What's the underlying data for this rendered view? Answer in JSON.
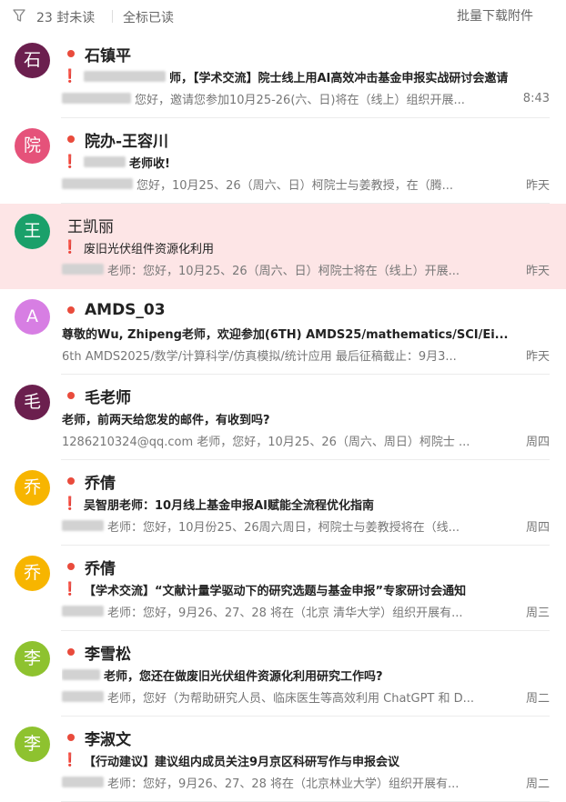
{
  "toolbar": {
    "filter_icon": "filter-icon",
    "unread_count_text": "23 封未读",
    "mark_all_read": "全标已读",
    "batch_download": "批量下载附件"
  },
  "colors": {
    "unread_dot": "#e94b3c",
    "flag": "#e02020",
    "selected_row": "#fde5e6"
  },
  "emails": [
    {
      "avatar": "石",
      "avatar_color": "#6b1f4e",
      "sender": "石镇平",
      "unread": true,
      "flag": true,
      "flag_symbol": "❗",
      "subject_prefix_blur": 90,
      "subject": "师，【学术交流】院士线上用AI高效冲击基金申报实战研讨会邀请",
      "preview_prefix_blur": 76,
      "preview": "您好，邀请您参加10月25-26(六、日)将在（线上）组织开展...",
      "time": "8:43",
      "selected": false
    },
    {
      "avatar": "院",
      "avatar_color": "#e5527a",
      "sender": "院办-王容川",
      "unread": true,
      "flag": true,
      "flag_symbol": "❗",
      "subject_prefix_blur": 46,
      "subject": "老师收!",
      "preview_prefix_blur": 78,
      "preview": "您好，10月25、26（周六、日）柯院士与姜教授，在（腾...",
      "time": "昨天",
      "selected": false
    },
    {
      "avatar": "王",
      "avatar_color": "#1aa06a",
      "sender": "王凯丽",
      "unread": false,
      "flag": true,
      "flag_symbol": "❗",
      "subject_prefix_blur": 0,
      "subject": "废旧光伏组件资源化利用",
      "preview_prefix_blur": 46,
      "preview": "老师：您好，10月25、26（周六、日）柯院士将在（线上）开展...",
      "time": "昨天",
      "selected": true
    },
    {
      "avatar": "A",
      "avatar_color": "#d77ee3",
      "sender": "AMDS_03",
      "unread": true,
      "flag": false,
      "flag_symbol": "",
      "subject_prefix_blur": 0,
      "subject": "尊敬的Wu, Zhipeng老师，欢迎参加(6TH) AMDS25/mathematics/SCI/Ei...",
      "preview_prefix_blur": 0,
      "preview": "6th AMDS2025/数学/计算科学/仿真模拟/统计应用 最后征稿截止：9月3...",
      "time": "昨天",
      "selected": false
    },
    {
      "avatar": "毛",
      "avatar_color": "#6b1f4e",
      "sender": "毛老师",
      "unread": true,
      "flag": false,
      "flag_symbol": "",
      "subject_prefix_blur": 0,
      "subject": "老师，前两天给您发的邮件，有收到吗?",
      "preview_prefix_blur": 0,
      "preview": "1286210324@qq.com 老师，您好，10月25、26（周六、周日）柯院士 ...",
      "time": "周四",
      "selected": false
    },
    {
      "avatar": "乔",
      "avatar_color": "#f7b500",
      "sender": "乔倩",
      "unread": true,
      "flag": true,
      "flag_symbol": "❗",
      "subject_prefix_blur": 0,
      "subject": "吴智朋老师：10月线上基金申报AI赋能全流程优化指南",
      "preview_prefix_blur": 46,
      "preview": "老师：您好，10月份25、26周六周日，柯院士与姜教授将在（线...",
      "time": "周四",
      "selected": false
    },
    {
      "avatar": "乔",
      "avatar_color": "#f7b500",
      "sender": "乔倩",
      "unread": true,
      "flag": true,
      "flag_symbol": "❗",
      "subject_prefix_blur": 0,
      "subject": "【学术交流】“文献计量学驱动下的研究选题与基金申报”专家研讨会通知",
      "preview_prefix_blur": 46,
      "preview": "老师：您好，9月26、27、28 将在（北京 清华大学）组织开展有...",
      "time": "周三",
      "selected": false
    },
    {
      "avatar": "李",
      "avatar_color": "#8ec22f",
      "sender": "李雪松",
      "unread": true,
      "flag": false,
      "flag_symbol": "",
      "subject_prefix_blur": 42,
      "subject": "老师，您还在做废旧光伏组件资源化利用研究工作吗?",
      "preview_prefix_blur": 46,
      "preview": "老师，您好（为帮助研究人员、临床医生等高效利用 ChatGPT 和 D...",
      "time": "周二",
      "selected": false
    },
    {
      "avatar": "李",
      "avatar_color": "#8ec22f",
      "sender": "李淑文",
      "unread": true,
      "flag": true,
      "flag_symbol": "❗",
      "subject_prefix_blur": 0,
      "subject": "【行动建议】建议组内成员关注9月京区科研写作与申报会议",
      "preview_prefix_blur": 46,
      "preview": "老师：您好，9月26、27、28 将在（北京林业大学）组织开展有...",
      "time": "周二",
      "selected": false
    }
  ]
}
